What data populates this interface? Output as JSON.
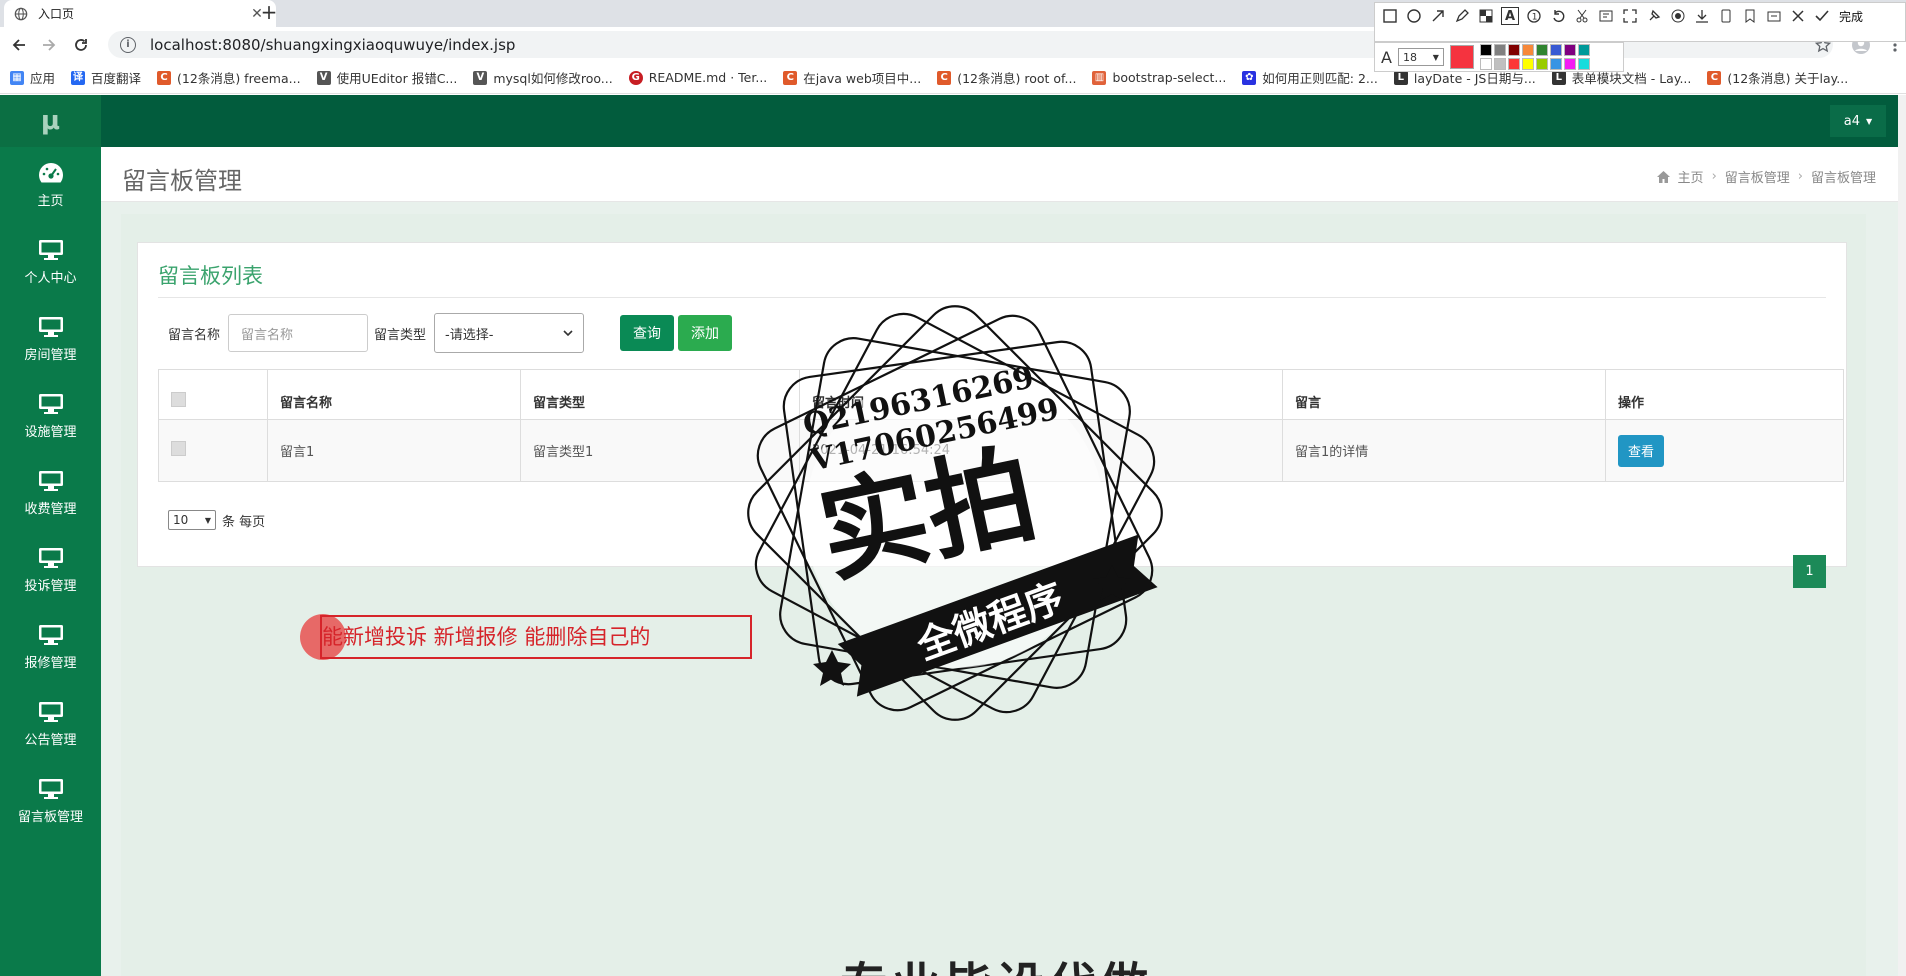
{
  "browser": {
    "tab_title": "入口页",
    "tab_close": "✕",
    "new_tab": "+",
    "url": "localhost:8080/shuangxingxiaoquwuye/index.jsp",
    "bookmarks": [
      {
        "label": "应用",
        "color": "#4285f4"
      },
      {
        "label": "百度翻译",
        "color": "#2468f2"
      },
      {
        "label": "(12条消息) freema...",
        "color": "#e05a2b"
      },
      {
        "label": "使用UEditor 报错C...",
        "color": "#555555"
      },
      {
        "label": "mysql如何修改roo...",
        "color": "#555555"
      },
      {
        "label": "README.md · Ter...",
        "color": "#c71d23"
      },
      {
        "label": "在java web项目中...",
        "color": "#e05a2b"
      },
      {
        "label": "(12条消息) root of...",
        "color": "#e05a2b"
      },
      {
        "label": "bootstrap-select...",
        "color": "#e0623a"
      },
      {
        "label": "如何用正则匹配: 2...",
        "color": "#2932e1"
      },
      {
        "label": "layDate - JS日期与...",
        "color": "#333333"
      },
      {
        "label": "表单模块文档 - Lay...",
        "color": "#333333"
      },
      {
        "label": "(12条消息) 关于lay...",
        "color": "#e05a2b"
      }
    ]
  },
  "snip_tool": {
    "done_label": "完成",
    "font_size": "18",
    "current_color": "#f5333f",
    "palette": [
      "#000000",
      "#808080",
      "#800000",
      "#f7883a",
      "#308430",
      "#385ad3",
      "#800080",
      "#009999",
      "#ffffff",
      "#c0c0c0",
      "#fb3838",
      "#ffff00",
      "#99cc00",
      "#3894e4",
      "#f31bf3",
      "#16dcdc"
    ]
  },
  "app": {
    "logo": "μ",
    "user": "a4",
    "sidebar": [
      {
        "label": "主页",
        "icon": "dashboard-icon"
      },
      {
        "label": "个人中心",
        "icon": "monitor-icon"
      },
      {
        "label": "房间管理",
        "icon": "monitor-icon"
      },
      {
        "label": "设施管理",
        "icon": "monitor-icon"
      },
      {
        "label": "收费管理",
        "icon": "monitor-icon"
      },
      {
        "label": "投诉管理",
        "icon": "monitor-icon"
      },
      {
        "label": "报修管理",
        "icon": "monitor-icon"
      },
      {
        "label": "公告管理",
        "icon": "monitor-icon"
      },
      {
        "label": "留言板管理",
        "icon": "monitor-icon"
      }
    ],
    "page_title": "留言板管理",
    "breadcrumb": {
      "home": "主页",
      "level1": "留言板管理",
      "level2": "留言板管理"
    },
    "panel_title": "留言板列表",
    "filters": {
      "name_label": "留言名称",
      "name_placeholder": "留言名称",
      "type_label": "留言类型",
      "type_value": "-请选择-",
      "query_btn": "查询",
      "add_btn": "添加"
    },
    "table": {
      "headers": [
        "留言名称",
        "留言类型",
        "留言时间",
        "留言",
        "操作"
      ],
      "rows": [
        {
          "name": "留言1",
          "type": "留言类型1",
          "time": "2021-04-21 16:54:24",
          "message": "留言1的详情",
          "action": "查看"
        }
      ]
    },
    "page_size": {
      "value": "10",
      "suffix": "条 每页"
    },
    "pager": {
      "current": "1"
    }
  },
  "annotation": {
    "text": "能新增投诉 新增报修 能删除自己的"
  },
  "watermark": {
    "qq": "Q2196316269",
    "v": "V17060256499",
    "big": "实拍",
    "banner": "全微程序",
    "bottom": "专业毕设代做"
  }
}
